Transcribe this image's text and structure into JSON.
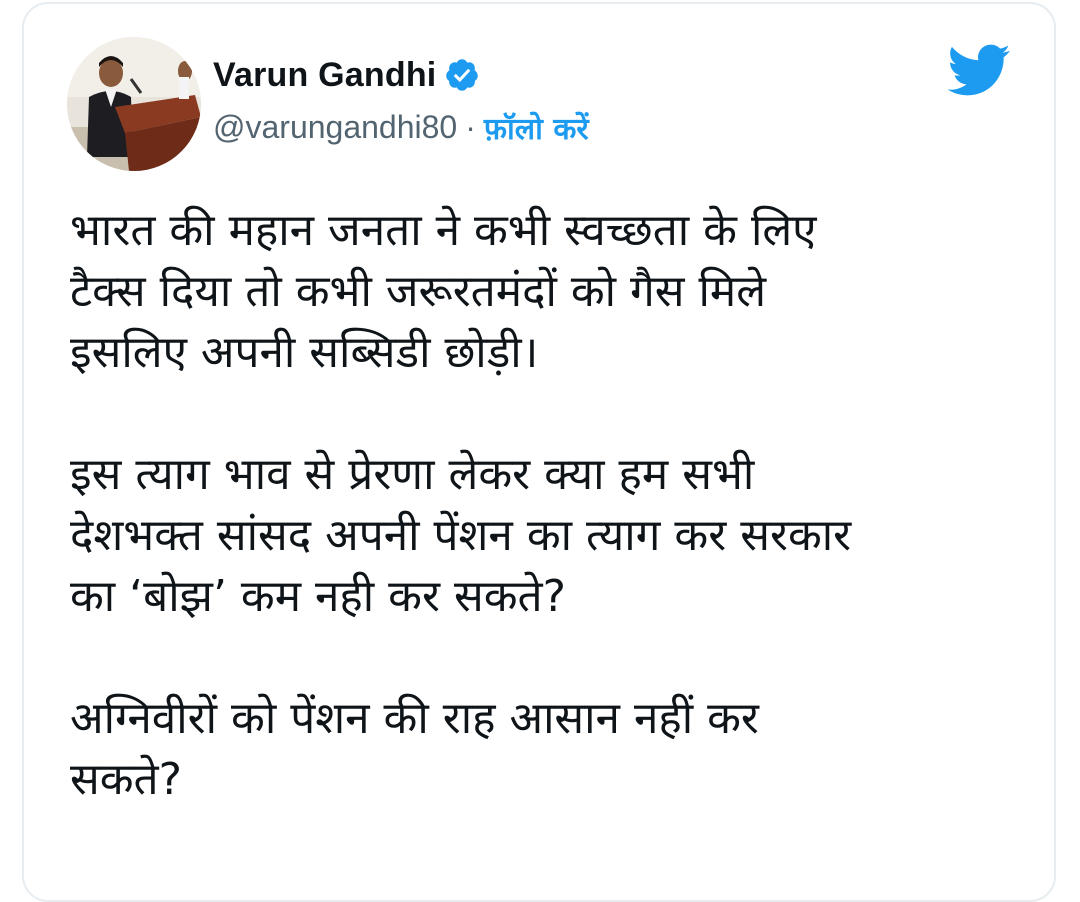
{
  "tweet": {
    "author": {
      "display_name": "Varun Gandhi",
      "handle": "@varungandhi80",
      "verified": true,
      "avatar_icon": "profile-photo-icon"
    },
    "separator": "·",
    "follow_label": "फ़ॉलो करें",
    "platform_icon": "twitter-bird-icon",
    "paragraphs": [
      "भारत की महान जनता ने कभी स्वच्छता के लिए\nटैक्स दिया तो कभी जरूरतमंदों को गैस मिले\nइसलिए अपनी सब्सिडी छोड़ी।",
      "इस त्याग भाव से प्रेरणा लेकर क्या हम सभी\nदेशभक्त सांसद अपनी पेंशन का त्याग कर सरकार\nका ‘बोझ’ कम नही कर सकते?",
      "अग्निवीरों को पेंशन की राह आसान नहीं कर\nसकते?"
    ]
  },
  "colors": {
    "accent": "#1d9bf0",
    "text": "#0f1419",
    "secondary_text": "#536471",
    "border": "#e6ecf0"
  }
}
